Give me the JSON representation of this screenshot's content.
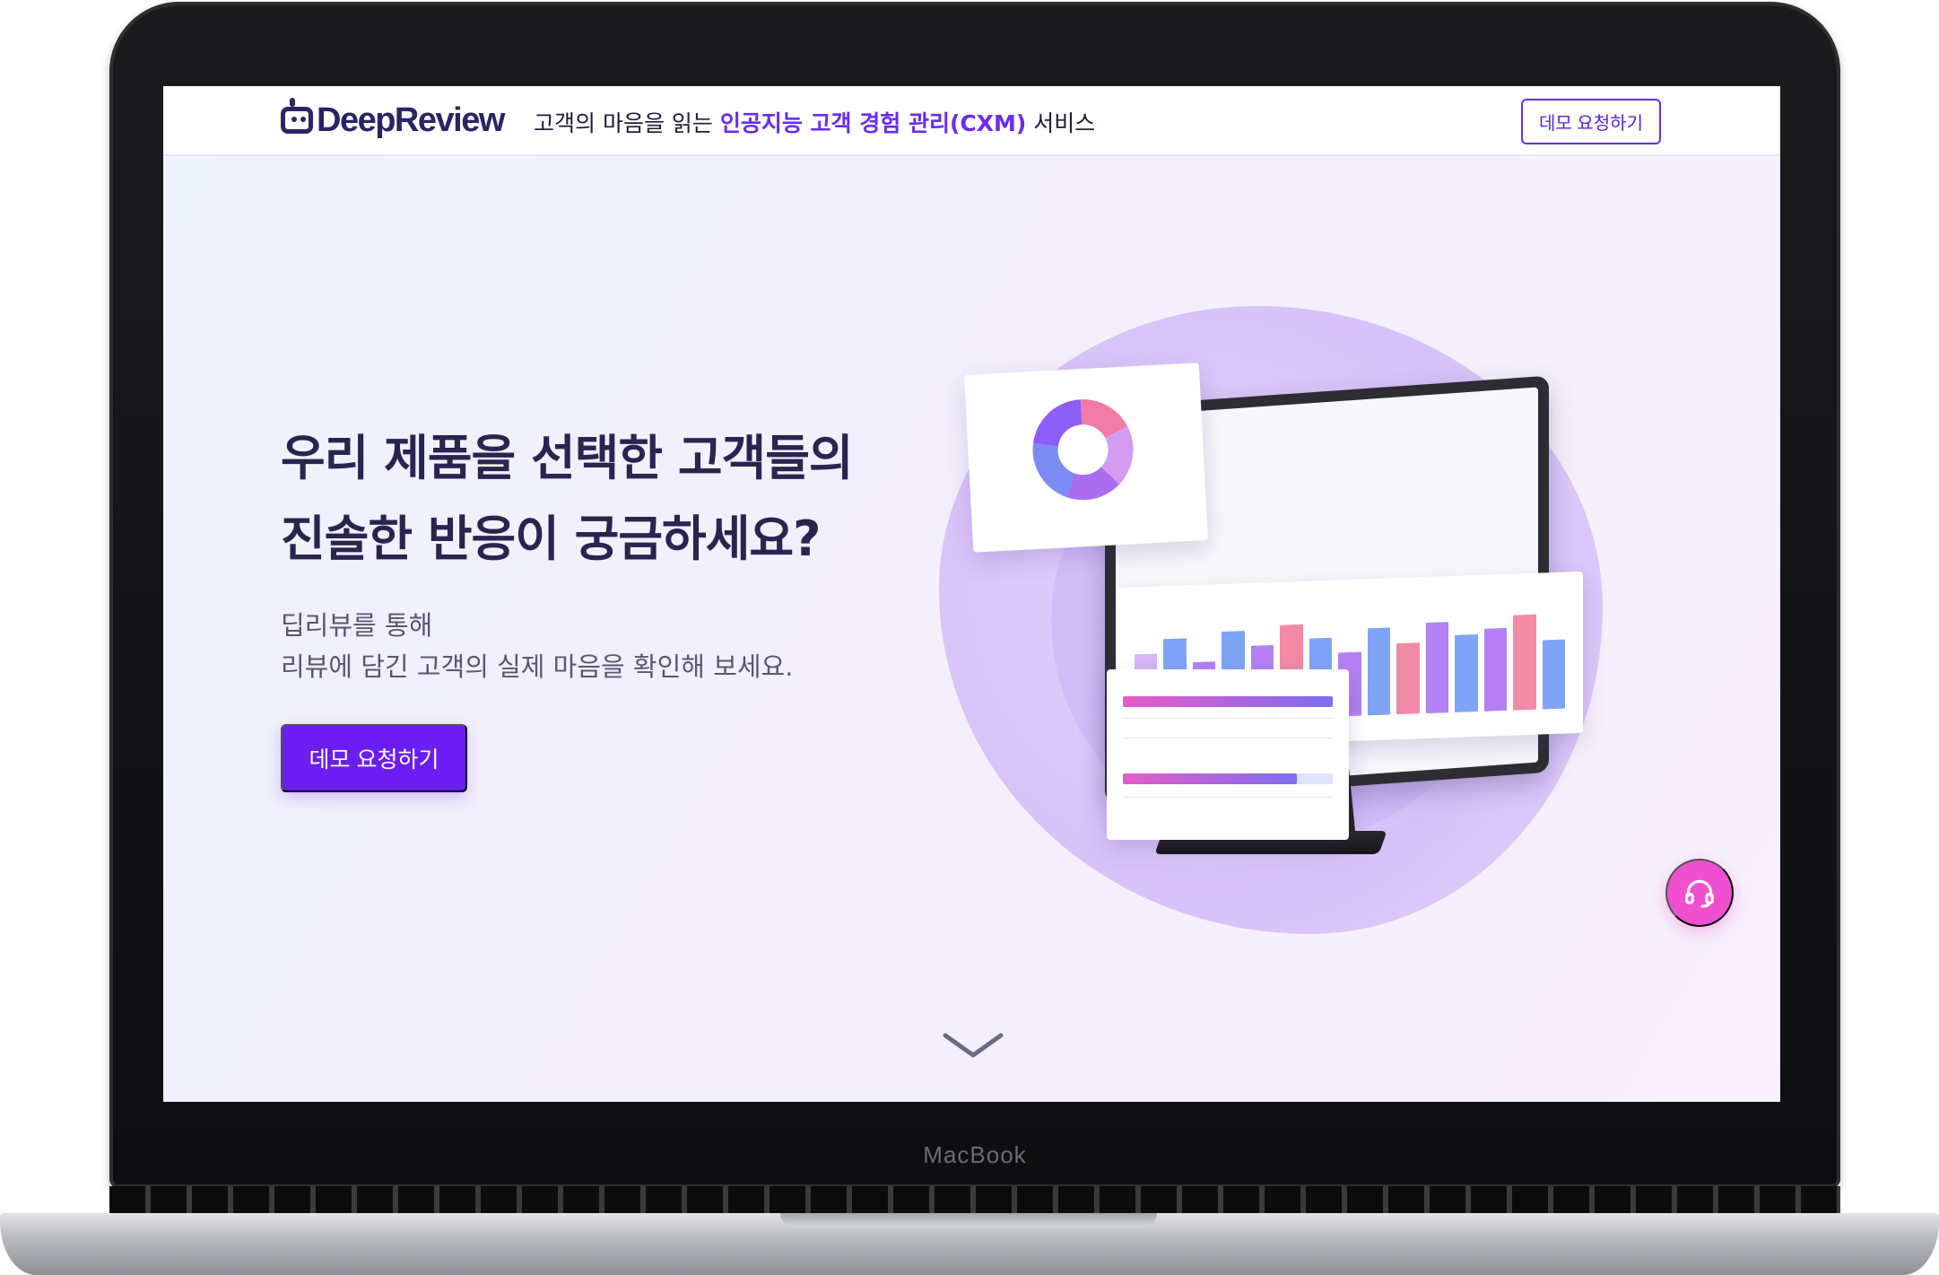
{
  "device": {
    "brand": "MacBook"
  },
  "nav": {
    "logo_text": "DeepReview",
    "tagline_prefix": "고객의 마음을 읽는 ",
    "tagline_highlight": "인공지능 고객 경험 관리(CXM)",
    "tagline_suffix": " 서비스",
    "demo_button_label": "데모 요청하기"
  },
  "hero": {
    "heading_line1": "우리 제품을 선택한 고객들의",
    "heading_line2": "진솔한 반응이 궁금하세요?",
    "sub_line1": "딥리뷰를 통해",
    "sub_line2": "리뷰에 담긴 고객의 실제 마음을 확인해 보세요.",
    "cta_label": "데모 요청하기"
  },
  "colors": {
    "brand_dark": "#2a2464",
    "accent_purple": "#6a1ef2",
    "help_pink": "#f04fcf"
  },
  "icons": {
    "help": "headset-icon",
    "scroll": "chevron-down-icon"
  }
}
